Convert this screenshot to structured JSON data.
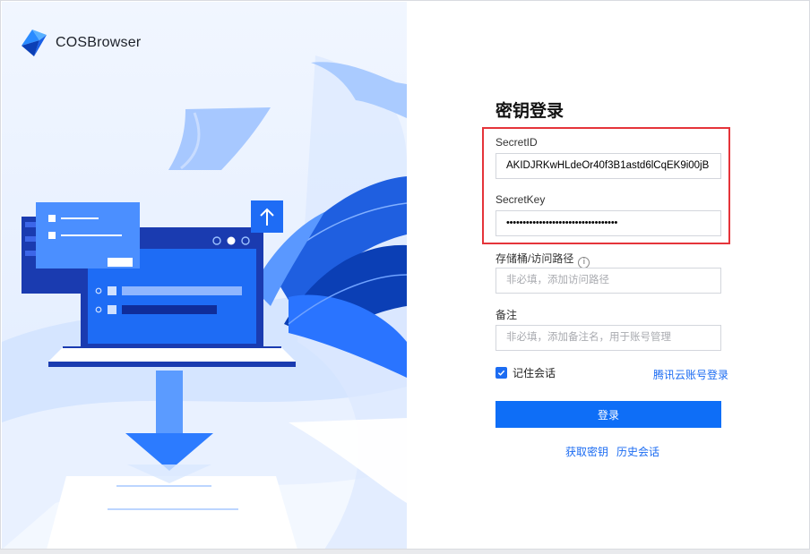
{
  "app": {
    "name": "COSBrowser"
  },
  "form": {
    "title": "密钥登录",
    "secret_id": {
      "label": "SecretID",
      "value": "AKIDJRKwHLdeOr40f3B1astd6lCqEK9i00jB"
    },
    "secret_key": {
      "label": "SecretKey",
      "value": "••••••••••••••••••••••••••••••••••"
    },
    "bucket_path": {
      "label": "存储桶/访问路径",
      "placeholder": "非必填，添加访问路径",
      "info_icon": "i"
    },
    "remark": {
      "label": "备注",
      "placeholder": "非必填，添加备注名，用于账号管理"
    },
    "remember": {
      "label": "记住会话",
      "checked": true
    },
    "account_login_link": "腾讯云账号登录",
    "login_button": "登录",
    "get_key_link": "获取密钥",
    "history_link": "历史会话"
  },
  "colors": {
    "accent": "#0e6ef7",
    "highlight": "#e5343a",
    "link": "#1c6cf2"
  },
  "icons": {
    "logo": "cosbrowser-logo-icon",
    "info": "info-icon",
    "check": "check-icon",
    "upload": "arrow-up-icon",
    "download": "arrow-down-icon"
  }
}
